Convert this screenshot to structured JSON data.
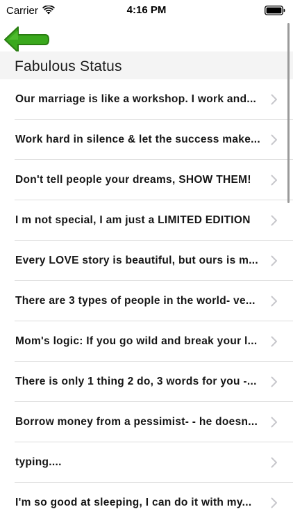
{
  "status_bar": {
    "carrier": "Carrier",
    "time": "4:16 PM",
    "icons": [
      "wifi-icon",
      "battery-icon"
    ]
  },
  "nav": {
    "back_icon": "arrow-left-icon",
    "back_color": "#3aa81d"
  },
  "section": {
    "title": "Fabulous Status"
  },
  "items": [
    {
      "text": "Our marriage is like a workshop. I work and..."
    },
    {
      "text": "Work hard in silence & let the success make..."
    },
    {
      "text": "Don't tell people your dreams, SHOW THEM!"
    },
    {
      "text": "I m not special, I am just a LIMITED EDITION"
    },
    {
      "text": "Every LOVE story is beautiful, but ours is m..."
    },
    {
      "text": "There are 3 types of people in the world- ve..."
    },
    {
      "text": "Mom's logic: If you go wild and break your l..."
    },
    {
      "text": "There is only 1 thing 2 do, 3 words for you -..."
    },
    {
      "text": "Borrow money from a pessimist- - he doesn..."
    },
    {
      "text": "typing...."
    },
    {
      "text": "I'm so good at sleeping, I can do it with my..."
    }
  ],
  "colors": {
    "accent_green": "#3aa81d",
    "header_bg": "#f4f4f4",
    "chevron": "#c7c7cc"
  }
}
